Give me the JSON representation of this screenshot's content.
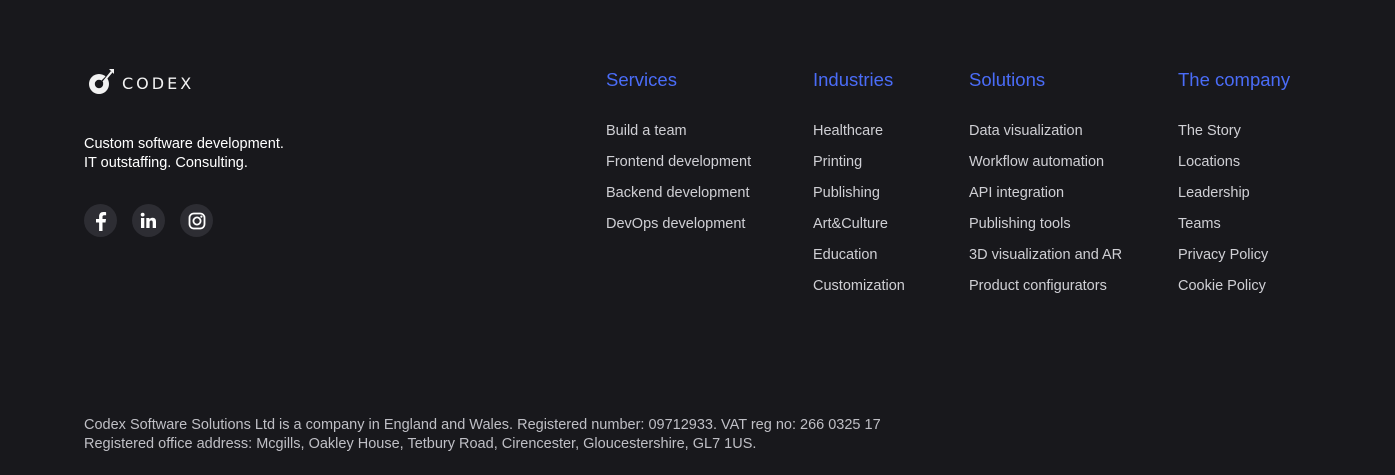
{
  "brand": {
    "name": "CODEX",
    "tagline_line1": "Custom software development.",
    "tagline_line2": "IT outstaffing. Consulting."
  },
  "socials": [
    {
      "icon": "facebook-icon"
    },
    {
      "icon": "linkedin-icon"
    },
    {
      "icon": "instagram-icon"
    }
  ],
  "columns": [
    {
      "title": "Services",
      "items": [
        "Build a team",
        "Frontend development",
        "Backend development",
        "DevOps development"
      ]
    },
    {
      "title": "Industries",
      "items": [
        "Healthcare",
        "Printing",
        "Publishing",
        "Art&Culture",
        "Education",
        "Customization"
      ]
    },
    {
      "title": "Solutions",
      "items": [
        "Data visualization",
        "Workflow automation",
        "API integration",
        "Publishing tools",
        "3D visualization and AR",
        "Product configurators"
      ]
    },
    {
      "title": "The company",
      "items": [
        "The Story",
        "Locations",
        "Leadership",
        "Teams",
        "Privacy Policy",
        "Cookie Policy"
      ]
    }
  ],
  "legal": {
    "line1": "Codex Software Solutions Ltd is a company in England and Wales. Registered number: 09712933. VAT reg no: 266 0325 17",
    "line2": "Registered office address: Mcgills, Oakley House, Tetbury Road, Cirencester, Gloucestershire, GL7 1US."
  },
  "colors": {
    "background": "#18181c",
    "accent": "#4a6cf7",
    "social_bg": "#2d2d33"
  }
}
